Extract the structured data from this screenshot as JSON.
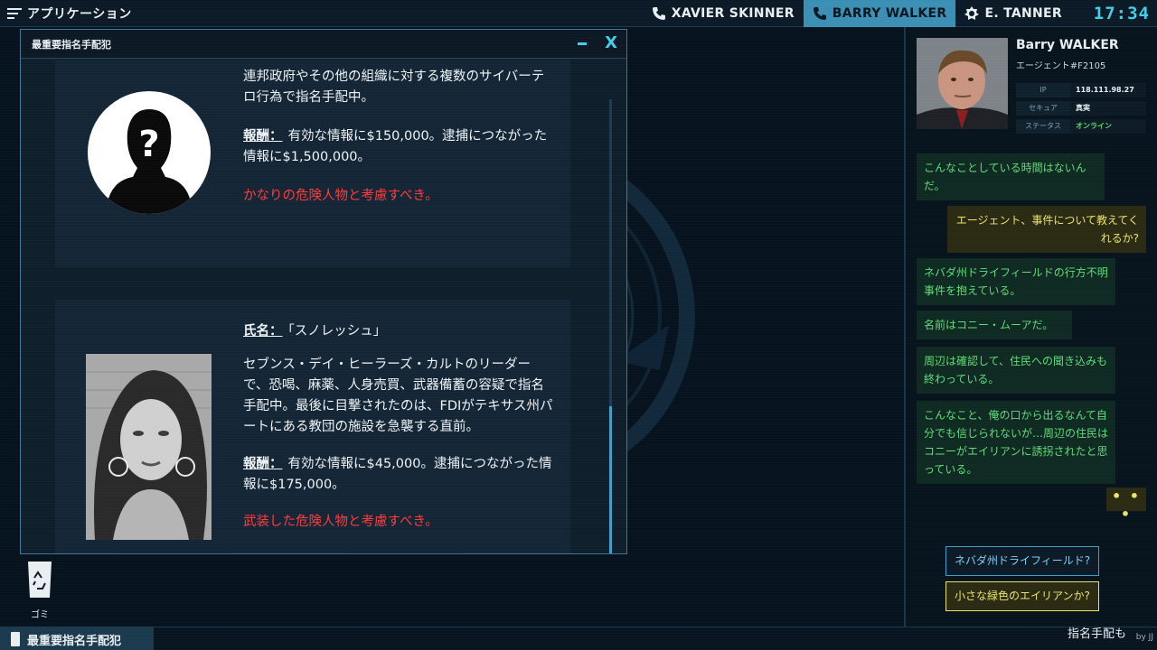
{
  "topbar": {
    "apps_label": "アプリケーション",
    "contacts": [
      {
        "name": "XAVIER SKINNER",
        "icon": "phone-icon",
        "active": false
      },
      {
        "name": "BARRY WALKER",
        "icon": "phone-icon",
        "active": true
      },
      {
        "name": "E. TANNER",
        "icon": "badge-icon",
        "active": false
      }
    ],
    "clock": "17:34"
  },
  "window": {
    "title": "最重要指名手配犯",
    "minimize": "–",
    "close": "X",
    "entries": [
      {
        "description": "連邦政府やその他の組織に対する複数のサイバーテロ行為で指名手配中。",
        "reward_label": "報酬：",
        "reward": "有効な情報に$150,000。逮捕につながった情報に$1,500,000。",
        "warning": "かなりの危険人物と考慮すべき。"
      },
      {
        "name_label": "氏名：",
        "name": "「スノレッシュ」",
        "description": "セブンス・デイ・ヒーラーズ・カルトのリーダーで、恐喝、麻薬、人身売買、武器備蓄の容疑で指名手配中。最後に目撃されたのは、FDIがテキサス州パートにある教団の施設を急襲する直前。",
        "reward_label": "報酬：",
        "reward": "有効な情報に$45,000。逮捕につながった情報に$175,000。",
        "warning": "武装した危険人物と考慮すべき。"
      }
    ]
  },
  "desktop": {
    "trash_label": "ゴミ"
  },
  "taskbar": {
    "item_label": "最重要指名手配犯",
    "credit": "by JJ"
  },
  "chat": {
    "agent_name": "Barry WALKER",
    "agent_id": "エージェント#F2105",
    "info": [
      {
        "key": "IP",
        "value": "118.111.98.27"
      },
      {
        "key": "セキュア",
        "value": "真実"
      },
      {
        "key": "ステータス",
        "value": "オンライン"
      }
    ],
    "messages": [
      {
        "from": "them",
        "text": "こんなことしている時間はないんだ。"
      },
      {
        "from": "me",
        "text": "エージェント、事件について教えてくれるか?"
      },
      {
        "from": "them",
        "text": "ネバダ州ドライフィールドの行方不明事件を抱えている。"
      },
      {
        "from": "them",
        "text": "名前はコニー・ムーアだ。"
      },
      {
        "from": "them",
        "text": "周辺は確認して、住民への聞き込みも終わっている。"
      },
      {
        "from": "them",
        "text": "こんなこと、俺の口から出るなんて自分でも信じられないが…周辺の住民はコニーがエイリアンに誘拐されたと思っている。"
      }
    ],
    "typing": "• • •",
    "choices": [
      "ネバダ州ドライフィールド?",
      "小さな緑色のエイリアンか?"
    ],
    "footer_label": "指名手配も"
  },
  "colors": {
    "accent": "#3ed0e8",
    "danger": "#ff3b3b",
    "chat_green": "#5edc7a",
    "chat_yellow": "#e9e36a"
  }
}
